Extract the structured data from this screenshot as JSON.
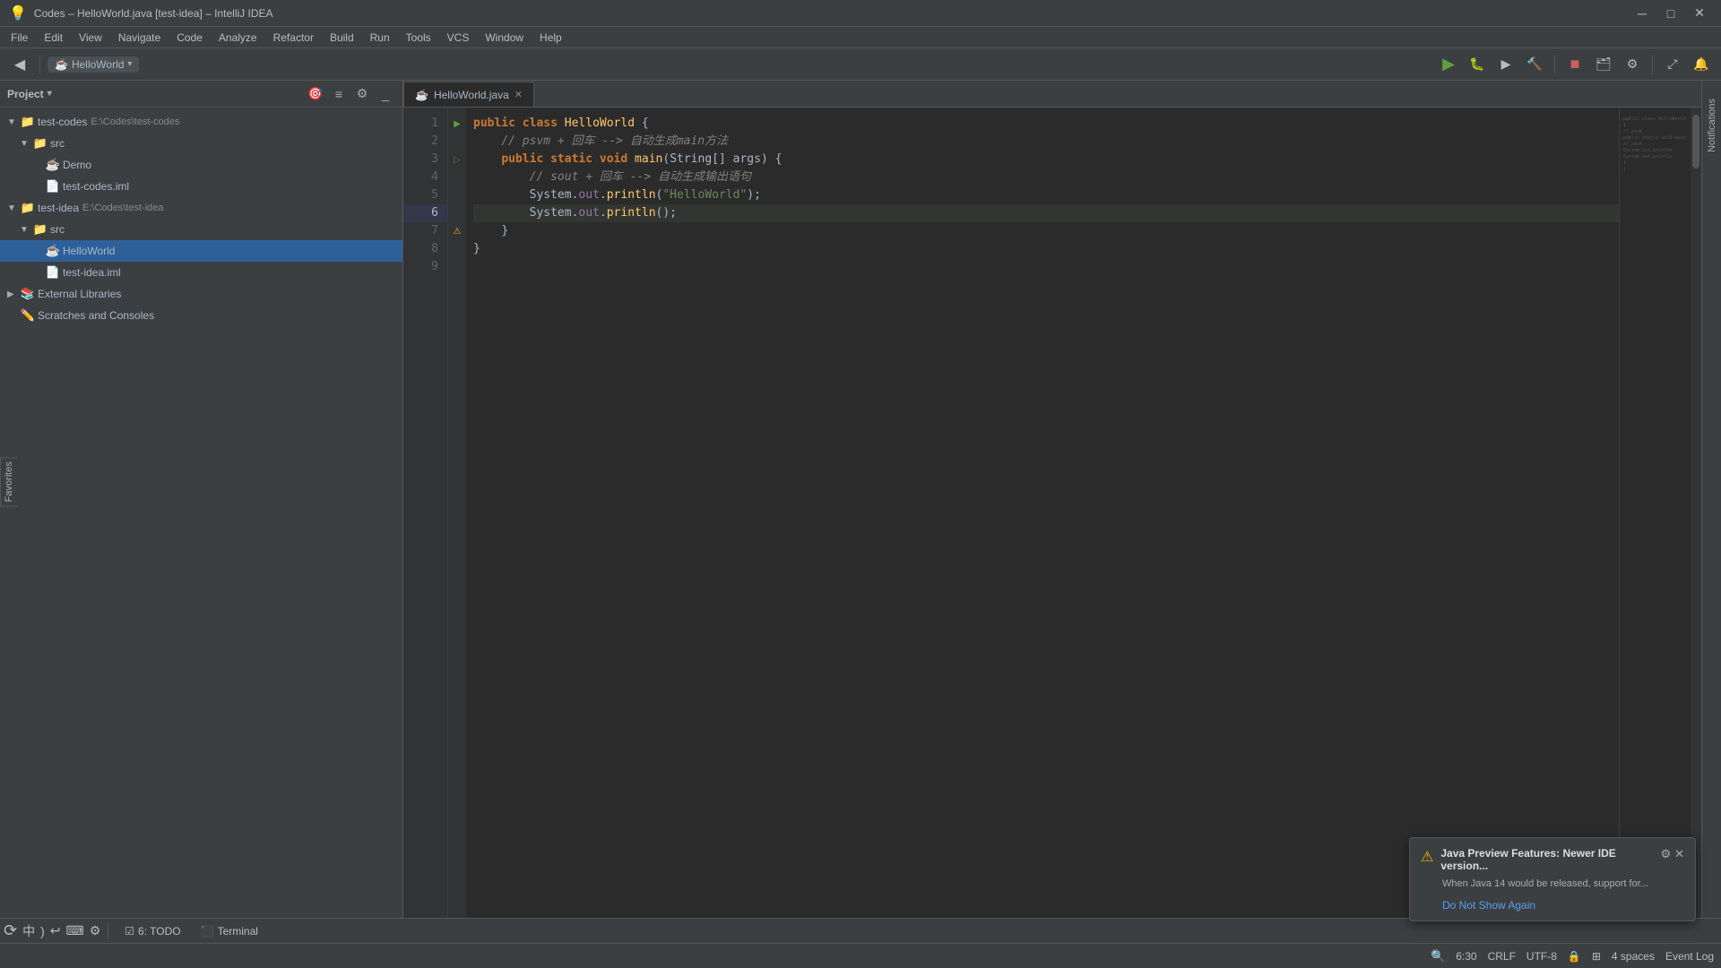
{
  "window": {
    "title": "Codes – HelloWorld.java [test-idea] – IntelliJ IDEA",
    "minimize": "─",
    "maximize": "□",
    "close": "✕"
  },
  "menu": {
    "items": [
      "File",
      "Edit",
      "View",
      "Navigate",
      "Code",
      "Analyze",
      "Refactor",
      "Build",
      "Run",
      "Tools",
      "VCS",
      "Window",
      "Help"
    ]
  },
  "toolbar": {
    "back_label": "◀",
    "forward_label": "▶",
    "run_config": "HelloWorld",
    "config_arrow": "▾"
  },
  "project_panel": {
    "title": "Project",
    "title_arrow": "▾",
    "tree": [
      {
        "level": 0,
        "arrow": "▼",
        "icon": "📁",
        "label": "test-codes",
        "extra": "E:\\Codes\\test-codes",
        "type": "module"
      },
      {
        "level": 1,
        "arrow": "▼",
        "icon": "📁",
        "label": "src",
        "extra": "",
        "type": "folder"
      },
      {
        "level": 2,
        "arrow": " ",
        "icon": "☕",
        "label": "Demo",
        "extra": "",
        "type": "java"
      },
      {
        "level": 2,
        "arrow": " ",
        "icon": "📄",
        "label": "test-codes.iml",
        "extra": "",
        "type": "iml"
      },
      {
        "level": 0,
        "arrow": "▼",
        "icon": "📁",
        "label": "test-idea",
        "extra": "E:\\Codes\\test-idea",
        "type": "module"
      },
      {
        "level": 1,
        "arrow": "▼",
        "icon": "📁",
        "label": "src",
        "extra": "",
        "type": "folder"
      },
      {
        "level": 2,
        "arrow": " ",
        "icon": "☕",
        "label": "HelloWorld",
        "extra": "",
        "type": "java"
      },
      {
        "level": 2,
        "arrow": " ",
        "icon": "📄",
        "label": "test-idea.iml",
        "extra": "",
        "type": "iml"
      },
      {
        "level": 0,
        "arrow": "▶",
        "icon": "📚",
        "label": "External Libraries",
        "extra": "",
        "type": "library"
      },
      {
        "level": 0,
        "arrow": " ",
        "icon": "✏️",
        "label": "Scratches and Consoles",
        "extra": "",
        "type": "scratch"
      }
    ]
  },
  "editor": {
    "tab_label": "HelloWorld.java",
    "lines": [
      {
        "num": 1,
        "gutter": "run",
        "content_html": "<span class='kw'>public</span> <span class='kw'>class</span> <span class='cls'>HelloWorld</span> <span class='plain'>{</span>"
      },
      {
        "num": 2,
        "gutter": "",
        "content_html": "    <span class='comment'>// psvm + 回车 --> 自动生成main方法</span>"
      },
      {
        "num": 3,
        "gutter": "run",
        "content_html": "    <span class='kw'>public</span> <span class='kw'>static</span> <span class='kw'>void</span> <span class='method'>main</span><span class='plain'>(</span><span class='type'>String</span><span class='plain'>[]</span> <span class='plain'>args) {</span>"
      },
      {
        "num": 4,
        "gutter": "",
        "content_html": "        <span class='comment'>// sout + 回车 --> 自动生成输出语句</span>"
      },
      {
        "num": 5,
        "gutter": "",
        "content_html": "        <span class='type'>System</span><span class='plain'>.</span><span class='field'>out</span><span class='plain'>.</span><span class='method'>println</span><span class='plain'>(</span><span class='str'>\"HelloWorld\"</span><span class='plain'>);</span>"
      },
      {
        "num": 6,
        "gutter": "",
        "content_html": "        <span class='type'>System</span><span class='plain'>.</span><span class='field'>out</span><span class='plain'>.</span><span class='method'>println</span><span class='plain'>();</span>"
      },
      {
        "num": 7,
        "gutter": "warn",
        "content_html": "    <span class='plain'>}</span>"
      },
      {
        "num": 8,
        "gutter": "",
        "content_html": "<span class='plain'>}</span>"
      },
      {
        "num": 9,
        "gutter": "",
        "content_html": ""
      }
    ]
  },
  "bottom_tabs": [
    {
      "label": "6: TODO",
      "icon": "☑"
    },
    {
      "label": "Terminal",
      "icon": "⬛"
    }
  ],
  "status_bar": {
    "line_col": "6:30",
    "line_ending": "CRLF",
    "encoding": "UTF-8",
    "indent": "4 spaces",
    "event_log": "Event Log"
  },
  "notification": {
    "icon": "⚠",
    "title": "Java Preview Features:",
    "title_rest": " Newer IDE version...",
    "body": "When Java 14 would be released, support for...",
    "link": "Do Not Show Again"
  },
  "right_sidebar": {
    "label": "Notifications"
  },
  "favorites": {
    "label": "Favorites"
  }
}
